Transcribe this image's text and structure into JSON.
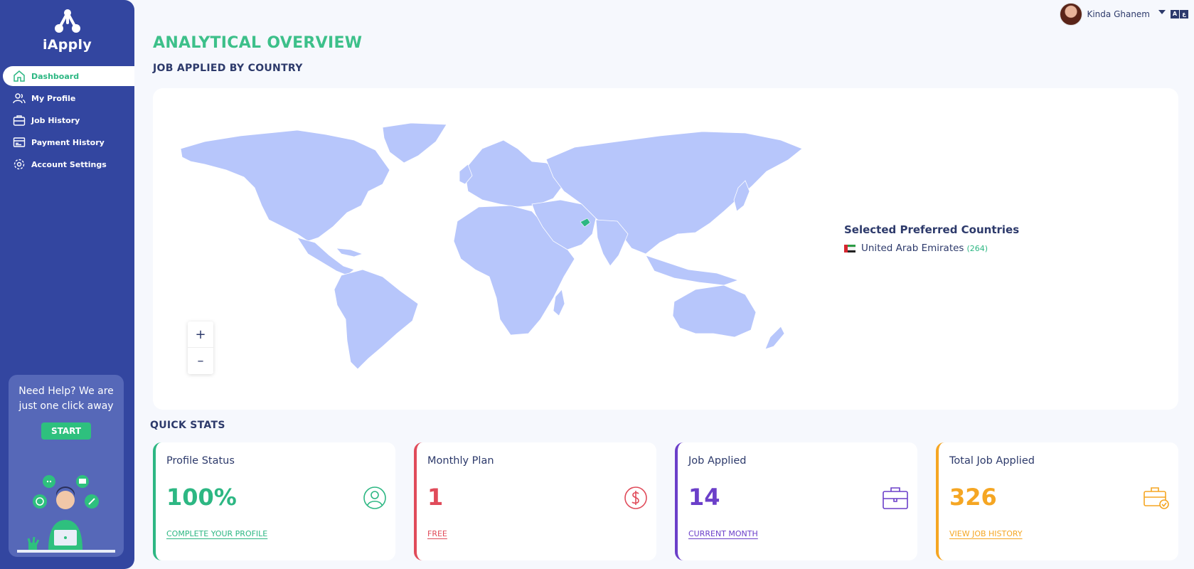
{
  "app": {
    "name": "iApply"
  },
  "sidebar": {
    "items": [
      {
        "label": "Dashboard",
        "icon": "home-icon",
        "active": true
      },
      {
        "label": "My Profile",
        "icon": "users-icon"
      },
      {
        "label": "Job History",
        "icon": "briefcase-icon"
      },
      {
        "label": "Payment History",
        "icon": "list-icon"
      },
      {
        "label": "Account Settings",
        "icon": "gear-icon"
      }
    ],
    "help": {
      "text": "Need Help? We are just one click away",
      "button": "START"
    }
  },
  "header": {
    "user_name": "Kinda Ghanem",
    "lang_glyphs": [
      "A",
      "ع"
    ]
  },
  "page_title": "ANALYTICAL OVERVIEW",
  "map_section": {
    "title": "JOB APPLIED BY COUNTRY",
    "zoom_in": "+",
    "zoom_out": "–",
    "legend_title": "Selected Preferred Countries",
    "countries": [
      {
        "name": "United Arab Emirates",
        "count": "(264)"
      }
    ],
    "colors": {
      "land": "#b7c6fb",
      "highlight": "#2db783"
    }
  },
  "quick_stats": {
    "title": "QUICK STATS",
    "cards": [
      {
        "label": "Profile Status",
        "value": "100%",
        "link": "COMPLETE YOUR PROFILE",
        "color": "#2db783",
        "icon": "user-circle-icon"
      },
      {
        "label": "Monthly Plan",
        "value": "1",
        "link": "FREE",
        "color": "#e04b5a",
        "icon": "dollar-circle-icon"
      },
      {
        "label": "Job Applied",
        "value": "14",
        "link": "CURRENT MONTH",
        "color": "#6b3fc9",
        "icon": "briefcase-icon"
      },
      {
        "label": "Total Job Applied",
        "value": "326",
        "link": "VIEW JOB HISTORY",
        "color": "#f5a623",
        "icon": "briefcase-check-icon"
      }
    ]
  }
}
